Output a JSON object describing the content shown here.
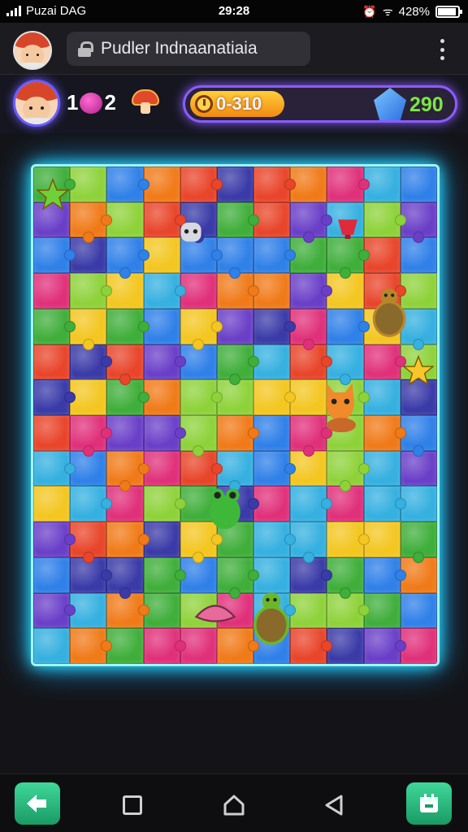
{
  "status": {
    "carrier": "Puzai DAG",
    "time": "29:28",
    "battery": "428%",
    "battery_level": 0.9
  },
  "browser": {
    "title": "Pudler Indnaanatiaia"
  },
  "hud": {
    "level_left": "1",
    "level_right": "2",
    "timer": "0-310",
    "gems": "290"
  },
  "colors": {
    "board_glow": "#2ee6ff",
    "hud_border": "#8a5cff",
    "timer": "#f7a520",
    "gems_text": "#7ce642",
    "nav_button": "#2cbf80"
  },
  "board": {
    "cols": 11,
    "rows": 14,
    "palette": [
      "#3fae3a",
      "#e8452a",
      "#f3c620",
      "#2f80e8",
      "#6a3fc8",
      "#e0307a",
      "#f07a18",
      "#35b0e0",
      "#8ed23a",
      "#3a3aa8"
    ],
    "cells": [
      "0690399299 3",
      "3334098909 3",
      "1574319421 1",
      "2358431730 5",
      "6623003730 3",
      "6223050262 3",
      "3404424263 3",
      "4631394451 6",
      "9341593041 6",
      "3623304400 8",
      "4923405364 0",
      "2643494434 5",
      "2302833200 1",
      "4136438403 2"
    ]
  },
  "critters": [
    {
      "name": "green-star-critter",
      "icon": "star",
      "color": "#6fd13a"
    },
    {
      "name": "orange-fox-critter",
      "icon": "fox",
      "color": "#f08a2a"
    },
    {
      "name": "green-frog-critter",
      "icon": "frog",
      "color": "#3fb83a"
    },
    {
      "name": "turtle-critter",
      "icon": "turtle",
      "color": "#b8862a"
    },
    {
      "name": "green-turtle-critter",
      "icon": "turtle",
      "color": "#6ab82a"
    },
    {
      "name": "gray-robot-critter",
      "icon": "robot",
      "color": "#d8d8e0"
    },
    {
      "name": "red-cup-critter",
      "icon": "cup",
      "color": "#e02a3a"
    },
    {
      "name": "pink-shell-critter",
      "icon": "shell",
      "color": "#e86a9a"
    },
    {
      "name": "yellow-star-critter",
      "icon": "star",
      "color": "#f7c62a"
    }
  ],
  "nav": {
    "left_button": "home-arrow-icon",
    "right_button": "calendar-icon"
  }
}
